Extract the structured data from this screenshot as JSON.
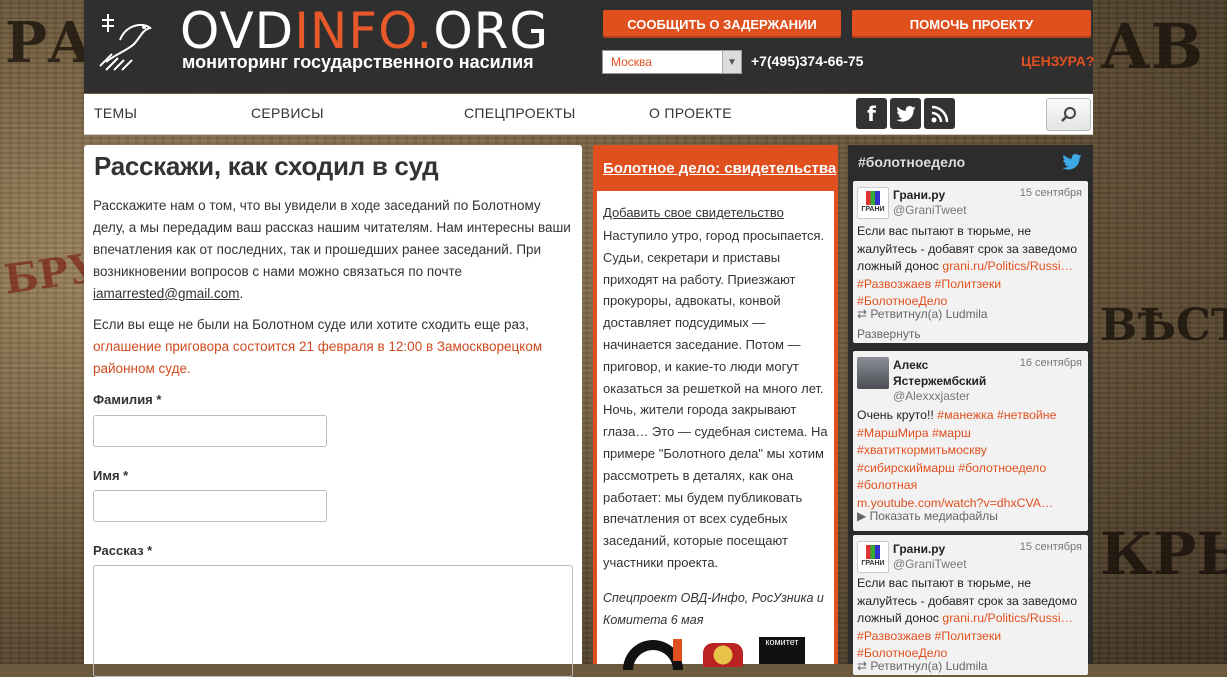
{
  "background_words": {
    "l1": "РАЛ",
    "l2": "БРУ",
    "r1": "АВ",
    "r2": "КРЫ",
    "r3": "ВѢСТ"
  },
  "header": {
    "logo_prefix": "OVD",
    "logo_accent": "INFO.",
    "logo_suffix": "ORG",
    "tagline": "мониторинг государственного насилия",
    "report_button": "СООБЩИТЬ О ЗАДЕРЖАНИИ",
    "help_button": "ПОМОЧЬ ПРОЕКТУ",
    "city": "Москва",
    "phone": "+7(495)374-66-75",
    "censorship": "ЦЕНЗУРА?"
  },
  "nav": {
    "items": [
      "ТЕМЫ",
      "СЕРВИСЫ",
      "СПЕЦПРОЕКТЫ",
      "О ПРОЕКТЕ"
    ],
    "social": {
      "facebook": "f",
      "twitter": "t",
      "rss": "rss"
    }
  },
  "main": {
    "title": "Расскажи, как сходил в суд",
    "intro": "Расскажите нам о том, что вы увидели в ходе заседаний по Болотному делу, а мы передадим ваш рассказ нашим читателям. Нам интересны ваши впечатления как от последних, так и прошедших ранее заседаний. При возникновении вопросов с нами можно связаться по почте ",
    "email": "iamarrested@gmail.com",
    "intro_end": ".",
    "p2_text": "Если вы еще не были на Болотном суде или хотите сходить еще раз, ",
    "p2_highlight": "оглашение приговора состоится 21 февраля в 12:00 в Замоскворецком районном суде.",
    "form": {
      "surname_label": "Фамилия *",
      "name_label": "Имя *",
      "story_label": "Рассказ *"
    }
  },
  "mid": {
    "heading": "Болотное дело: свидетельства",
    "add_link": "Добавить свое свидетельство",
    "body": "Наступило утро, город просыпается. Судьи, секретари и приставы приходят на работу. Приезжают прокуроры, адвокаты, конвой доставляет подсудимых — начинается заседание. Потом — приговор, и какие-то люди могут оказаться за решеткой на много лет. Ночь, жители города закрывают глаза… Это — судебная система. На примере \"Болотного дела\" мы хотим рассмотреть в деталях, как она работает: мы будем публиковать впечатления от всех судебных заседаний, которые посещают участники проекта.",
    "credit": "Спецпроект ОВД-Инфо, РосУзника и Комитета 6 мая",
    "logo3_text": "комитет"
  },
  "twitter": {
    "hashtag": "#болотноедело",
    "tweets": [
      {
        "name": "Грани.ру",
        "handle": "@GraniTweet",
        "date": "15 сентября",
        "text": "Если вас пытают в тюрьме, не жалуйтесь - добавят срок за заведомо ложный донос ",
        "link": "grani.ru/Politics/Russi…",
        "tags": "#Развозжаев #Политзеки #БолотноеДело",
        "retweet": "Ретвитнул(а) Ludmila",
        "expand": "Развернуть"
      },
      {
        "name": "Алекс Ястержембский",
        "handle": "@Alexxxjaster",
        "date": "16 сентября",
        "text": "Очень круто!! ",
        "tags": "#манежка #нетвойне #МаршМира #марш #хватиткормитьмоскву #сибирскиймарш #болотноедело #болотная",
        "link": "m.youtube.com/watch?v=dhxCVA…",
        "media": "Показать медиафайлы"
      },
      {
        "name": "Грани.ру",
        "handle": "@GraniTweet",
        "date": "15 сентября",
        "text": "Если вас пытают в тюрьме, не жалуйтесь - добавят срок за заведомо ложный донос ",
        "link": "grani.ru/Politics/Russi…",
        "tags": "#Развозжаев #Политзеки #БолотноеДело",
        "retweet": "Ретвитнул(а) Ludmila"
      }
    ],
    "avatar_label": "ГРАНИ"
  }
}
